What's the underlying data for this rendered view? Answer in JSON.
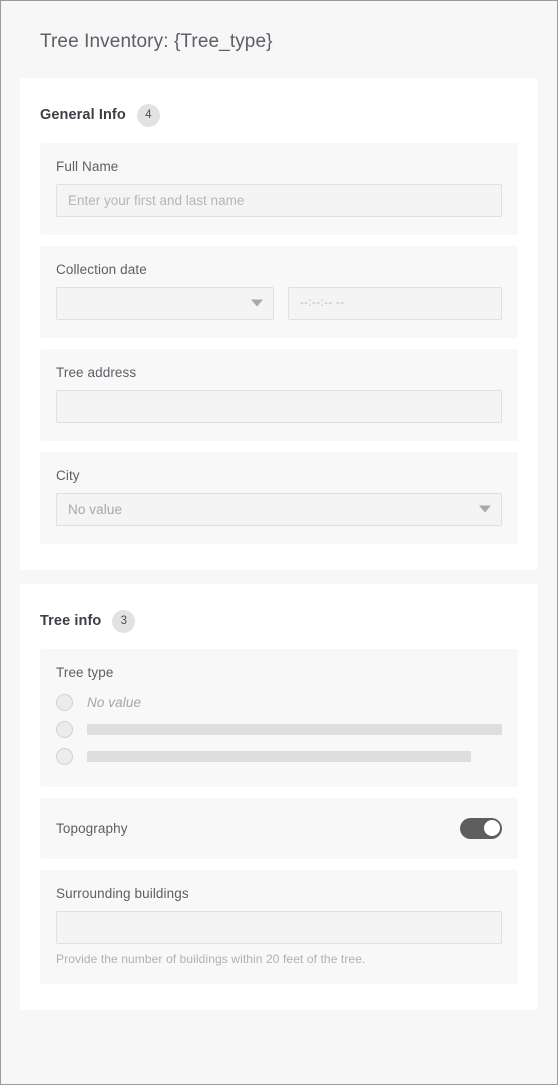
{
  "header": {
    "title": "Tree Inventory: {Tree_type}"
  },
  "sections": [
    {
      "title": "General Info",
      "badge": "4",
      "fields": [
        {
          "label": "Full Name",
          "type": "text",
          "value": "",
          "placeholder": "Enter your first and last name"
        },
        {
          "label": "Collection date",
          "type": "datetime",
          "date_value": "",
          "time_placeholder": "--:--:-- --"
        },
        {
          "label": "Tree address",
          "type": "text",
          "value": "",
          "placeholder": ""
        },
        {
          "label": "City",
          "type": "select",
          "value": "No value"
        }
      ]
    },
    {
      "title": "Tree info",
      "badge": "3",
      "fields": [
        {
          "label": "Tree type",
          "type": "radio",
          "options": [
            {
              "label": "No value",
              "placeholder_bar": false
            },
            {
              "label": "",
              "placeholder_bar": true
            },
            {
              "label": "",
              "placeholder_bar": true
            }
          ]
        },
        {
          "label": "Topography",
          "type": "toggle",
          "state": "on"
        },
        {
          "label": "Surrounding buildings",
          "type": "text",
          "value": "",
          "placeholder": "",
          "hint": "Provide the number of buildings within 20 feet of the tree."
        }
      ]
    }
  ],
  "colors": {
    "page_background": "#f7f7f7",
    "card_background": "#ffffff",
    "field_background": "#f8f8f8",
    "input_background": "#f4f4f4",
    "toggle_on": "#5e5e5e",
    "badge_background": "#e2e2e2"
  }
}
